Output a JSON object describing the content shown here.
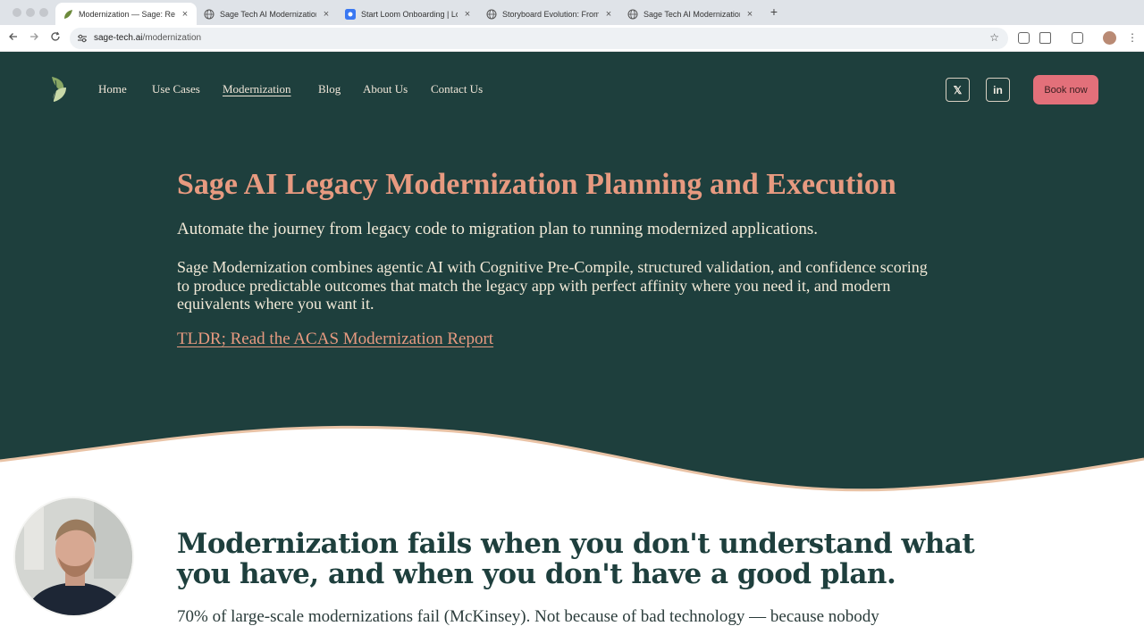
{
  "browser": {
    "tabs": [
      {
        "title": "Modernization — Sage: Revea",
        "active": true,
        "icon": "sage-leaf-icon"
      },
      {
        "title": "Sage Tech AI Modernization A",
        "active": false,
        "icon": "globe-icon"
      },
      {
        "title": "Start Loom Onboarding | Loo",
        "active": false,
        "icon": "loom-icon"
      },
      {
        "title": "Storyboard Evolution: From W",
        "active": false,
        "icon": "globe-icon"
      },
      {
        "title": "Sage Tech AI Modernization A",
        "active": false,
        "icon": "globe-icon"
      }
    ],
    "close_glyph": "×",
    "new_tab_glyph": "+",
    "url_host": "sage-tech.ai",
    "url_path": "/modernization"
  },
  "nav": {
    "items": [
      "Home",
      "Use Cases",
      "Modernization",
      "Blog",
      "About Us",
      "Contact Us"
    ],
    "current": "Modernization",
    "social": [
      {
        "label": "𝕏",
        "icon": "x-twitter-icon"
      },
      {
        "label": "in",
        "icon": "linkedin-icon"
      }
    ],
    "cta": "Book now"
  },
  "hero": {
    "title": "Sage AI Legacy Modernization Planning and Execution",
    "lead": "Automate the journey from legacy code to migration plan to running modernized applications.",
    "body": "Sage Modernization combines agentic AI with Cognitive Pre-Compile, structured validation, and confidence scoring to produce predictable outcomes that match the legacy app with perfect affinity where you need it, and modern equivalents where you want it.",
    "link": "TLDR; Read the ACAS Modernization Report"
  },
  "section": {
    "heading": "Modernization fails when you don't understand what you have, and when you don't have a good plan.",
    "text": "70% of large-scale modernizations fail (McKinsey). Not because of bad technology — because nobody"
  },
  "colors": {
    "hero_bg": "#1e3f3d",
    "accent": "#e79a80",
    "cta_bg": "#e3707a",
    "cream": "#f2ead8"
  }
}
